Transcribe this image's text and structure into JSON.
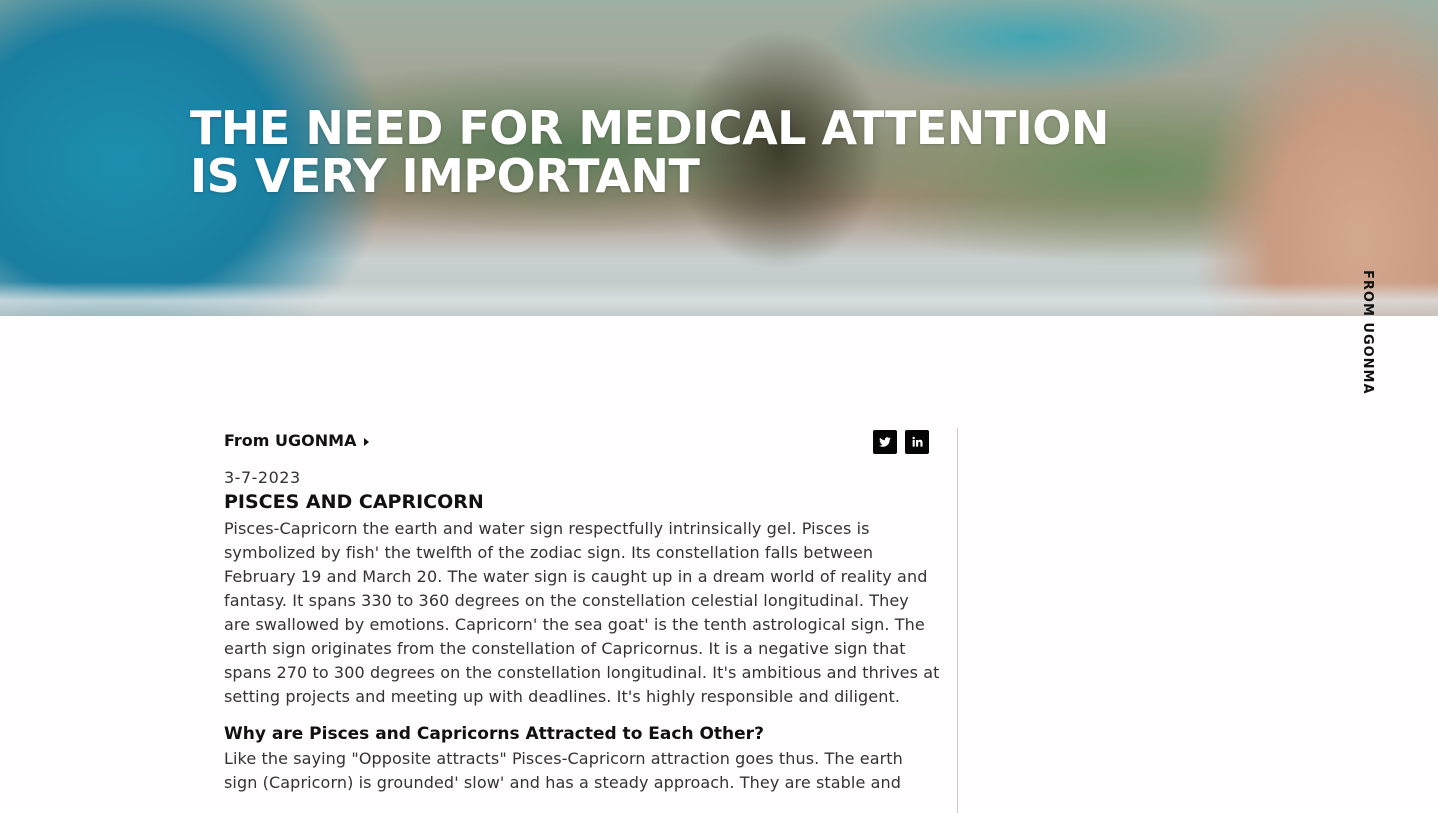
{
  "hero": {
    "title_line1": "THE NEED FOR MEDICAL ATTENTION",
    "title_line2": "IS VERY IMPORTANT"
  },
  "side_label": "FROM UGONMA",
  "article": {
    "author_link": "From UGONMA",
    "social": [
      {
        "name": "twitter-icon"
      },
      {
        "name": "linkedin-icon"
      }
    ],
    "date": "3-7-2023",
    "heading": "PISCES AND CAPRICORN",
    "paragraph1": "Pisces-Capricorn the earth and water sign respectfully intrinsically gel. Pisces is symbolized by fish' the twelfth of the zodiac sign. Its constellation falls between February 19 and March 20. The water sign is caught up in a dream world of reality and fantasy. It spans 330 to 360 degrees on the constellation celestial longitudinal. They are swallowed by emotions. Capricorn' the sea goat' is the tenth astrological sign. The earth sign originates from the constellation of Capricornus. It is a negative sign that spans 270 to 300 degrees on the constellation longitudinal. It's ambitious and thrives at setting projects and meeting up with deadlines. It's highly responsible and diligent.",
    "subheading": "Why are Pisces and Capricorns Attracted to Each Other?",
    "paragraph2": "Like the saying \"Opposite attracts\" Pisces-Capricorn attraction goes thus. The earth sign (Capricorn) is grounded' slow' and has a steady approach. They are stable and"
  }
}
